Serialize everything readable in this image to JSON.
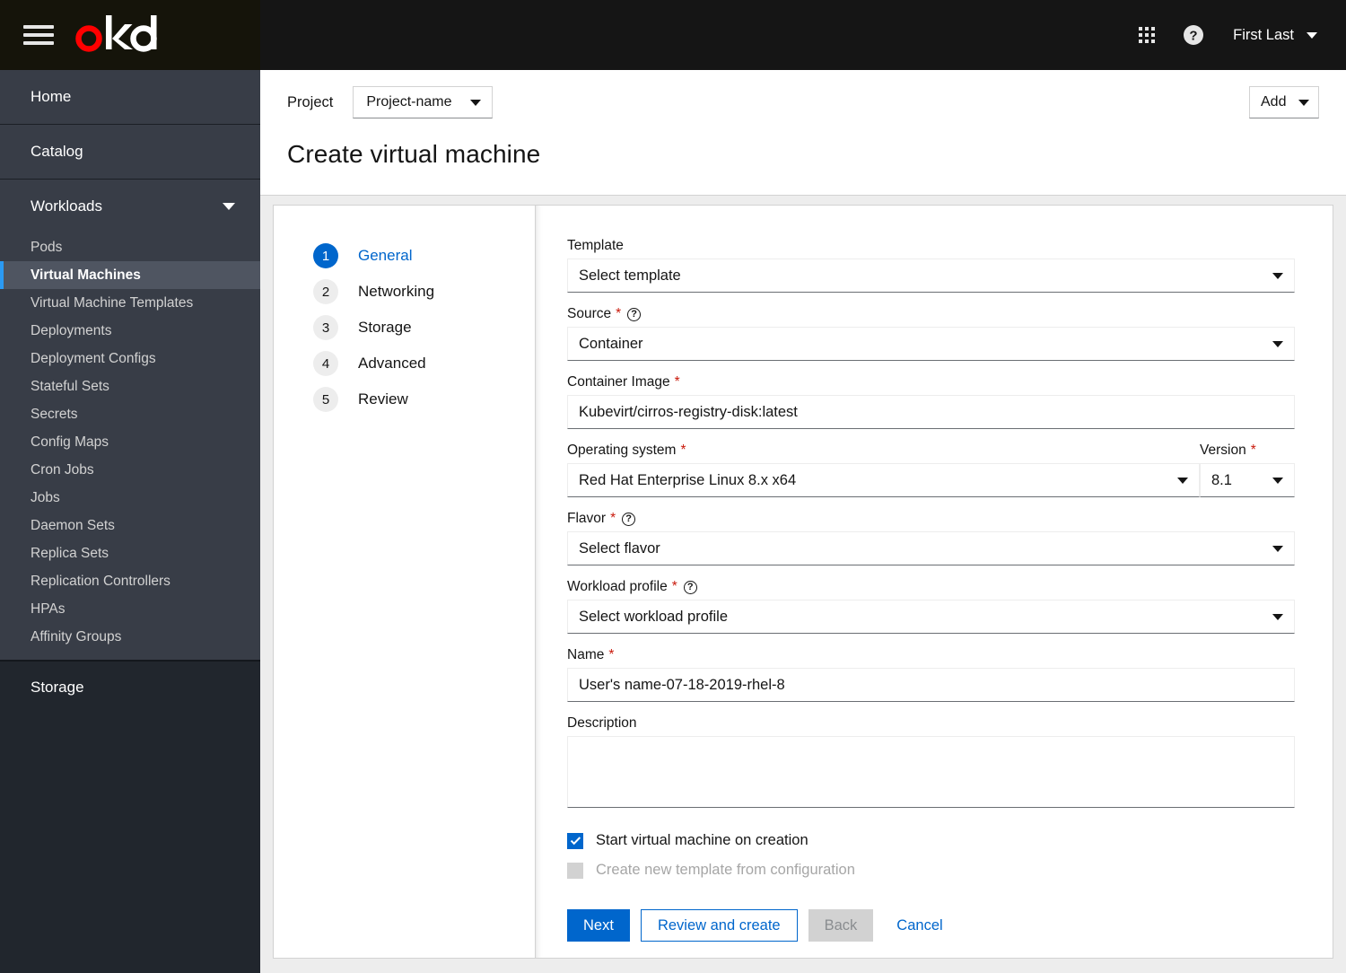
{
  "masthead": {
    "toggle_icon": "hamburger-icon",
    "logo_text": "okd",
    "apps_icon": "grid-apps-icon",
    "help_icon": "help-circle-icon",
    "user_name": "First Last",
    "user_caret_icon": "caret-down-icon"
  },
  "sidebar": {
    "top_items": [
      {
        "label": "Home"
      },
      {
        "label": "Catalog"
      }
    ],
    "group": {
      "label": "Workloads",
      "chevron_icon": "chevron-down-icon",
      "items": [
        {
          "label": "Pods",
          "active": false
        },
        {
          "label": "Virtual Machines",
          "active": true
        },
        {
          "label": "Virtual Machine Templates",
          "active": false
        },
        {
          "label": "Deployments",
          "active": false
        },
        {
          "label": "Deployment Configs",
          "active": false
        },
        {
          "label": "Stateful Sets",
          "active": false
        },
        {
          "label": "Secrets",
          "active": false
        },
        {
          "label": "Config Maps",
          "active": false
        },
        {
          "label": "Cron Jobs",
          "active": false
        },
        {
          "label": "Jobs",
          "active": false
        },
        {
          "label": "Daemon Sets",
          "active": false
        },
        {
          "label": "Replica Sets",
          "active": false
        },
        {
          "label": "Replication Controllers",
          "active": false
        },
        {
          "label": "HPAs",
          "active": false
        },
        {
          "label": "Affinity Groups",
          "active": false
        }
      ]
    },
    "bottom_items": [
      {
        "label": "Storage"
      }
    ]
  },
  "header": {
    "project_label": "Project",
    "project_value": "Project-name",
    "project_caret_icon": "caret-down-icon",
    "add_label": "Add",
    "add_caret_icon": "caret-down-icon",
    "page_title": "Create virtual machine"
  },
  "wizard": {
    "steps": [
      {
        "num": "1",
        "label": "General"
      },
      {
        "num": "2",
        "label": "Networking"
      },
      {
        "num": "3",
        "label": "Storage"
      },
      {
        "num": "4",
        "label": "Advanced"
      },
      {
        "num": "5",
        "label": "Review"
      }
    ],
    "active_step_index": 0
  },
  "form": {
    "template": {
      "label": "Template",
      "value": "Select template",
      "caret_icon": "caret-down-icon"
    },
    "source": {
      "label": "Source",
      "required_mark": "*",
      "help_icon": "help-circle-icon",
      "help_glyph": "?",
      "value": "Container",
      "caret_icon": "caret-down-icon"
    },
    "container_image": {
      "label": "Container Image",
      "required_mark": "*",
      "value": "Kubevirt/cirros-registry-disk:latest"
    },
    "operating_system": {
      "label": "Operating system",
      "required_mark": "*",
      "value": "Red Hat Enterprise Linux 8.x x64",
      "caret_icon": "caret-down-icon"
    },
    "version": {
      "label": "Version",
      "required_mark": "*",
      "value": "8.1",
      "caret_icon": "caret-down-icon"
    },
    "flavor": {
      "label": "Flavor",
      "required_mark": "*",
      "help_icon": "help-circle-icon",
      "help_glyph": "?",
      "value": "Select flavor",
      "caret_icon": "caret-down-icon"
    },
    "workload_profile": {
      "label": "Workload profile",
      "required_mark": "*",
      "help_icon": "help-circle-icon",
      "help_glyph": "?",
      "value": "Select workload profile",
      "caret_icon": "caret-down-icon"
    },
    "name": {
      "label": "Name",
      "required_mark": "*",
      "value": "User's name-07-18-2019-rhel-8"
    },
    "description": {
      "label": "Description",
      "value": ""
    },
    "start_vm_checkbox": {
      "label": "Start virtual machine on creation",
      "checked": true,
      "disabled": false
    },
    "create_template_checkbox": {
      "label": "Create new template from configuration",
      "checked": false,
      "disabled": true
    },
    "buttons": {
      "next": "Next",
      "review_and_create": "Review and create",
      "back": "Back",
      "cancel": "Cancel"
    }
  },
  "colors": {
    "accent_blue": "#0066cc",
    "active_nav_blue": "#2b9af3",
    "required_red": "#c9190b",
    "logo_red": "#ff0000",
    "sidebar_bg": "#383d47",
    "sidebar_dark": "#21262d",
    "page_bg": "#ededed"
  }
}
